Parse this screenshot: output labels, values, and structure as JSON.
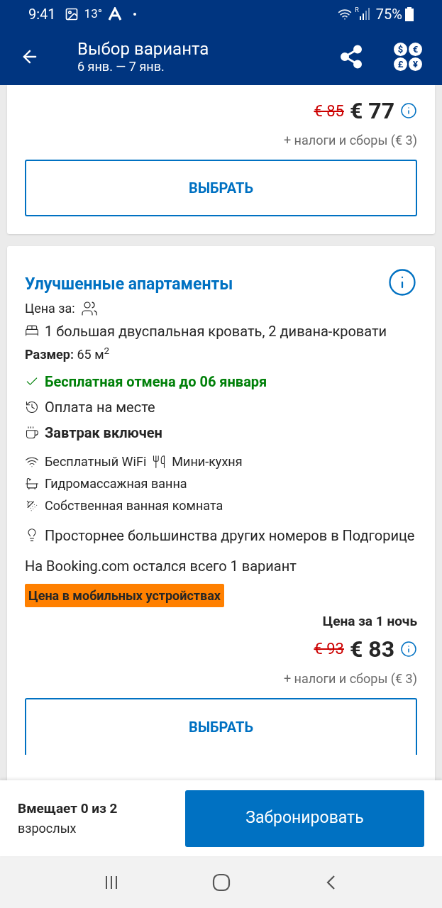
{
  "status_bar": {
    "time": "9:41",
    "temperature": "13°",
    "roaming_mark": "R",
    "battery": "75%"
  },
  "app_bar": {
    "title": "Выбор варианта",
    "subtitle": "6 янв. — 7 янв.",
    "currency_symbols": [
      "$",
      "€",
      "£",
      "¥"
    ]
  },
  "previous_offer": {
    "old_price": "€ 85",
    "price": "€ 77",
    "taxes": "+ налоги и сборы (€ 3)",
    "button": "ВЫБРАТЬ"
  },
  "offer": {
    "title": "Улучшенные апартаменты",
    "price_for": "Цена за:",
    "beds": "1 большая двуспальная кровать, 2 дивана-кровати",
    "size": "**Размер:** 65 м$^{2}$",
    "conditions": [
      {
        "kind": "cancellation",
        "text": "Бесплатная отмена до 06 января"
      },
      {
        "kind": "payment",
        "text": "Оплата на месте"
      },
      {
        "kind": "breakfast",
        "text": "Завтрак включен"
      }
    ],
    "amenity_rows": [
      [
        {
          "kind": "wifi",
          "text": "Бесплатный WiFi"
        },
        {
          "kind": "kitchen",
          "text": "Мини-кухня"
        }
      ],
      [
        {
          "kind": "bath",
          "text": "Гидромассажная ванна"
        }
      ],
      [
        {
          "kind": "shower",
          "text": "Собственная ванная комната"
        }
      ]
    ],
    "highlight": "Просторнее большинства других номеров в Подгорице",
    "availability": "На Booking.com остался всего 1 вариант",
    "badge": "Цена в мобильных устройствах",
    "price_label": "Цена за 1 ночь",
    "old_price": "€ 93",
    "price": "€ 83",
    "taxes": "+ налоги и сборы (€ 3)",
    "button": "ВЫБРАТЬ"
  },
  "footer": {
    "occupancy": "Вмещает 0 из 2",
    "occupancy_unit": "взрослых",
    "book_button": "Забронировать"
  }
}
